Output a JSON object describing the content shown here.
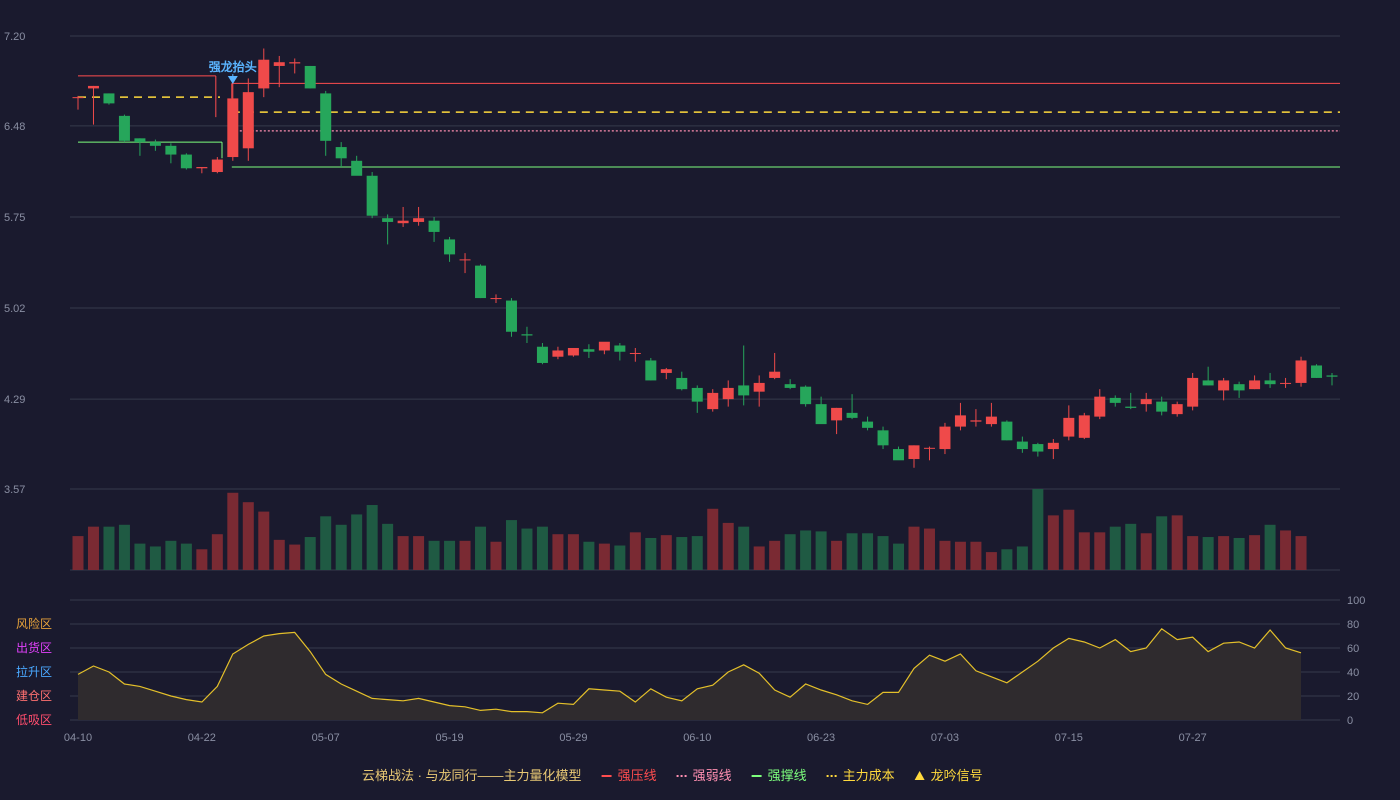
{
  "chart_data": {
    "type": "candlestick",
    "ylim": [
      3.57,
      7.2
    ],
    "yticks": [
      "7.20",
      "6.48",
      "5.75",
      "5.02",
      "4.29",
      "3.57"
    ],
    "x": [
      "04-10",
      "",
      "",
      "",
      "",
      "",
      "",
      "",
      "04-22",
      "",
      "",
      "",
      "",
      "",
      "",
      "",
      "05-07",
      "",
      "",
      "",
      "",
      "",
      "",
      "",
      "05-19",
      "",
      "",
      "",
      "",
      "",
      "",
      "",
      "05-29",
      "",
      "",
      "",
      "",
      "",
      "",
      "",
      "06-10",
      "",
      "",
      "",
      "",
      "",
      "",
      "",
      "06-23",
      "",
      "",
      "",
      "",
      "",
      "",
      "",
      "07-03",
      "",
      "",
      "",
      "",
      "",
      "",
      "",
      "07-15",
      "",
      "",
      "",
      "",
      "",
      "",
      "",
      "07-27",
      "",
      "",
      "",
      "",
      "",
      "",
      "",
      ""
    ],
    "ohlc": [
      [
        6.71,
        6.72,
        6.61,
        6.71
      ],
      [
        6.78,
        6.8,
        6.49,
        6.8
      ],
      [
        6.74,
        6.74,
        6.65,
        6.66
      ],
      [
        6.56,
        6.57,
        6.35,
        6.36
      ],
      [
        6.38,
        6.38,
        6.24,
        6.35
      ],
      [
        6.35,
        6.37,
        6.28,
        6.32
      ],
      [
        6.32,
        6.34,
        6.18,
        6.25
      ],
      [
        6.25,
        6.26,
        6.13,
        6.14
      ],
      [
        6.14,
        6.15,
        6.1,
        6.15
      ],
      [
        6.11,
        6.23,
        6.1,
        6.21
      ],
      [
        6.23,
        6.86,
        6.2,
        6.7
      ],
      [
        6.3,
        6.86,
        6.2,
        6.75
      ],
      [
        6.78,
        7.1,
        6.71,
        7.01
      ],
      [
        6.96,
        7.04,
        6.79,
        6.99
      ],
      [
        6.98,
        7.02,
        6.9,
        6.99
      ],
      [
        6.96,
        6.96,
        6.78,
        6.78
      ],
      [
        6.74,
        6.76,
        6.24,
        6.36
      ],
      [
        6.31,
        6.35,
        6.15,
        6.22
      ],
      [
        6.2,
        6.24,
        6.1,
        6.08
      ],
      [
        6.08,
        6.11,
        5.74,
        5.76
      ],
      [
        5.74,
        5.77,
        5.53,
        5.71
      ],
      [
        5.7,
        5.83,
        5.67,
        5.72
      ],
      [
        5.71,
        5.83,
        5.68,
        5.74
      ],
      [
        5.72,
        5.75,
        5.55,
        5.63
      ],
      [
        5.57,
        5.59,
        5.39,
        5.45
      ],
      [
        5.41,
        5.46,
        5.3,
        5.41
      ],
      [
        5.36,
        5.37,
        5.1,
        5.1
      ],
      [
        5.1,
        5.13,
        5.06,
        5.1
      ],
      [
        5.08,
        5.1,
        4.79,
        4.83
      ],
      [
        4.81,
        4.87,
        4.74,
        4.8
      ],
      [
        4.71,
        4.74,
        4.57,
        4.58
      ],
      [
        4.63,
        4.71,
        4.61,
        4.68
      ],
      [
        4.64,
        4.7,
        4.63,
        4.7
      ],
      [
        4.69,
        4.73,
        4.62,
        4.67
      ],
      [
        4.68,
        4.74,
        4.65,
        4.75
      ],
      [
        4.72,
        4.74,
        4.6,
        4.67
      ],
      [
        4.66,
        4.7,
        4.59,
        4.66
      ],
      [
        4.6,
        4.62,
        4.44,
        4.44
      ],
      [
        4.5,
        4.54,
        4.45,
        4.53
      ],
      [
        4.46,
        4.51,
        4.36,
        4.37
      ],
      [
        4.38,
        4.4,
        4.18,
        4.27
      ],
      [
        4.21,
        4.37,
        4.19,
        4.34
      ],
      [
        4.29,
        4.44,
        4.23,
        4.38
      ],
      [
        4.4,
        4.72,
        4.24,
        4.32
      ],
      [
        4.35,
        4.48,
        4.23,
        4.42
      ],
      [
        4.46,
        4.66,
        4.45,
        4.51
      ],
      [
        4.41,
        4.45,
        4.37,
        4.38
      ],
      [
        4.39,
        4.4,
        4.23,
        4.25
      ],
      [
        4.25,
        4.31,
        4.11,
        4.09
      ],
      [
        4.12,
        4.22,
        4.01,
        4.22
      ],
      [
        4.18,
        4.33,
        4.13,
        4.14
      ],
      [
        4.11,
        4.15,
        4.04,
        4.06
      ],
      [
        4.04,
        4.07,
        3.89,
        3.92
      ],
      [
        3.89,
        3.91,
        3.81,
        3.8
      ],
      [
        3.81,
        3.92,
        3.74,
        3.92
      ],
      [
        3.9,
        3.91,
        3.8,
        3.9
      ],
      [
        3.89,
        4.1,
        3.85,
        4.07
      ],
      [
        4.07,
        4.26,
        4.04,
        4.16
      ],
      [
        4.11,
        4.21,
        4.07,
        4.12
      ],
      [
        4.09,
        4.26,
        4.07,
        4.15
      ],
      [
        4.11,
        4.12,
        3.96,
        3.96
      ],
      [
        3.95,
        3.99,
        3.86,
        3.89
      ],
      [
        3.93,
        3.94,
        3.83,
        3.87
      ],
      [
        3.89,
        3.97,
        3.81,
        3.94
      ],
      [
        3.99,
        4.24,
        3.96,
        4.14
      ],
      [
        3.98,
        4.18,
        3.97,
        4.16
      ],
      [
        4.15,
        4.37,
        4.13,
        4.31
      ],
      [
        4.3,
        4.32,
        4.23,
        4.26
      ],
      [
        4.23,
        4.34,
        4.21,
        4.22
      ],
      [
        4.25,
        4.34,
        4.19,
        4.29
      ],
      [
        4.27,
        4.31,
        4.16,
        4.19
      ],
      [
        4.17,
        4.27,
        4.15,
        4.25
      ],
      [
        4.23,
        4.5,
        4.2,
        4.46
      ],
      [
        4.44,
        4.55,
        4.4,
        4.4
      ],
      [
        4.36,
        4.46,
        4.28,
        4.44
      ],
      [
        4.41,
        4.43,
        4.3,
        4.36
      ],
      [
        4.37,
        4.48,
        4.37,
        4.44
      ],
      [
        4.44,
        4.5,
        4.38,
        4.41
      ],
      [
        4.42,
        4.46,
        4.38,
        4.42
      ],
      [
        4.42,
        4.63,
        4.39,
        4.6
      ],
      [
        4.56,
        4.57,
        4.46,
        4.46
      ],
      [
        4.48,
        4.5,
        4.4,
        4.47
      ]
    ],
    "volume": [
      36,
      46,
      46,
      48,
      28,
      25,
      31,
      28,
      22,
      38,
      82,
      72,
      62,
      32,
      27,
      35,
      57,
      48,
      59,
      69,
      49,
      36,
      36,
      31,
      31,
      31,
      46,
      30,
      53,
      44,
      46,
      38,
      38,
      30,
      28,
      26,
      40,
      34,
      37,
      35,
      36,
      65,
      50,
      46,
      25,
      31,
      38,
      42,
      41,
      31,
      39,
      39,
      36,
      28,
      46,
      44,
      31,
      30,
      30,
      19,
      22,
      25,
      86,
      58,
      64,
      40,
      40,
      46,
      49,
      39,
      57,
      58,
      36,
      35,
      36,
      34,
      37,
      48,
      42,
      36
    ],
    "indicator": [
      38,
      45,
      40,
      30,
      28,
      24,
      20,
      17,
      15,
      28,
      55,
      63,
      70,
      72,
      73,
      57,
      38,
      30,
      24,
      18,
      17,
      16,
      18,
      15,
      12,
      11,
      8,
      9,
      7,
      7,
      6,
      14,
      13,
      26,
      25,
      24,
      15,
      26,
      19,
      16,
      26,
      29,
      40,
      46,
      39,
      25,
      19,
      30,
      25,
      21,
      16,
      13,
      23,
      23,
      43,
      54,
      49,
      55,
      41,
      36,
      31,
      40,
      49,
      60,
      68,
      65,
      60,
      67,
      57,
      60,
      76,
      67,
      69,
      57,
      64,
      65,
      60,
      75,
      60,
      56
    ],
    "lines": {
      "strong_pressure": [
        6.88,
        6.82
      ],
      "weak_line": 6.44,
      "support": 6.15,
      "main_cost": [
        6.71,
        6.59
      ]
    },
    "signal": {
      "label": "强龙抬头",
      "index": 10
    },
    "sub_axis_left": [
      "风险区",
      "出货区",
      "拉升区",
      "建仓区",
      "低吸区"
    ],
    "sub_axis_right": [
      "100",
      "80",
      "60",
      "40",
      "20",
      "0"
    ],
    "legend": [
      {
        "label": "云梯战法 · 与龙同行——主力量化模型",
        "color": "#e8c874",
        "marker": "none"
      },
      {
        "label": "强压线",
        "color": "#ff4d4f",
        "marker": "line"
      },
      {
        "label": "强弱线",
        "color": "#ff8fb1",
        "marker": "dashed"
      },
      {
        "label": "强撑线",
        "color": "#7dff7d",
        "marker": "line"
      },
      {
        "label": "主力成本",
        "color": "#ffd93d",
        "marker": "dashed"
      },
      {
        "label": "龙吟信号",
        "color": "#ffd93d",
        "marker": "triangle"
      }
    ],
    "colors": {
      "up": "#ef4a4a",
      "down": "#26a65b",
      "up_volume": "#7a2a33",
      "down_volume": "#1f5a43",
      "indicator_line": "#e4c02a",
      "signal": "#5ab4ff",
      "grid": "#363a4c",
      "tick": "#8a8fa3",
      "zone_risk": "#e8a33a",
      "zone_sell": "#e040fb",
      "zone_pull": "#4aa8ff",
      "zone_build": "#ff7070",
      "zone_low": "#ff4d6d",
      "right_100": "#3ddc4a",
      "right_80": "#f0a030",
      "right_60": "#e040fb",
      "right_40": "#4aa8ff",
      "right_20": "#ff7070",
      "right_0": "#ff4d6d"
    }
  }
}
